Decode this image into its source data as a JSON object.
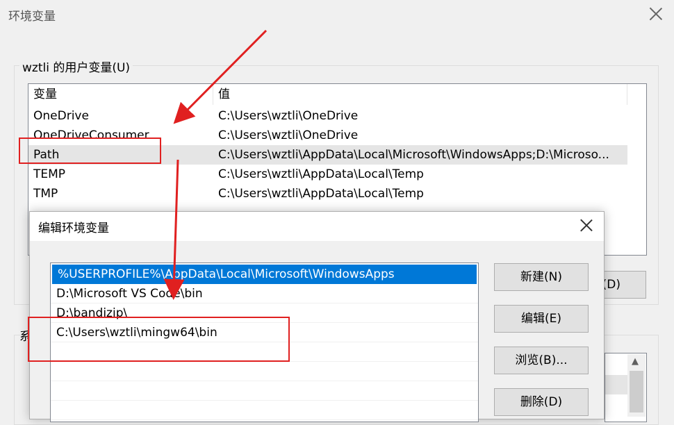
{
  "outer_dialog": {
    "title": "环境变量",
    "user_group_label": "wztli 的用户变量(U)",
    "columns": [
      "变量",
      "值"
    ],
    "rows": [
      {
        "var": "OneDrive",
        "val": "C:\\Users\\wztli\\OneDrive"
      },
      {
        "var": "OneDriveConsumer",
        "val": "C:\\Users\\wztli\\OneDrive"
      },
      {
        "var": "Path",
        "val": "C:\\Users\\wztli\\AppData\\Local\\Microsoft\\WindowsApps;D:\\Microso..."
      },
      {
        "var": "TEMP",
        "val": "C:\\Users\\wztli\\AppData\\Local\\Temp"
      },
      {
        "var": "TMP",
        "val": "C:\\Users\\wztli\\AppData\\Local\\Temp"
      }
    ],
    "delete_button_partial": "(D)",
    "system_group_label_partial": "系"
  },
  "edit_dialog": {
    "title": "编辑环境变量",
    "paths": [
      "%USERPROFILE%\\AppData\\Local\\Microsoft\\WindowsApps",
      "D:\\Microsoft VS Code\\bin",
      "D:\\bandizip\\",
      "C:\\Users\\wztli\\mingw64\\bin"
    ],
    "selected_index": 0,
    "buttons": {
      "new": "新建(N)",
      "edit": "编辑(E)",
      "browse": "浏览(B)...",
      "delete": "删除(D)"
    }
  },
  "annotations": {
    "color": "#e02020"
  },
  "colors": {
    "selection": "#0078d7",
    "row_highlight": "#e5e5e5",
    "dialog_bg": "#f0f0f0"
  }
}
